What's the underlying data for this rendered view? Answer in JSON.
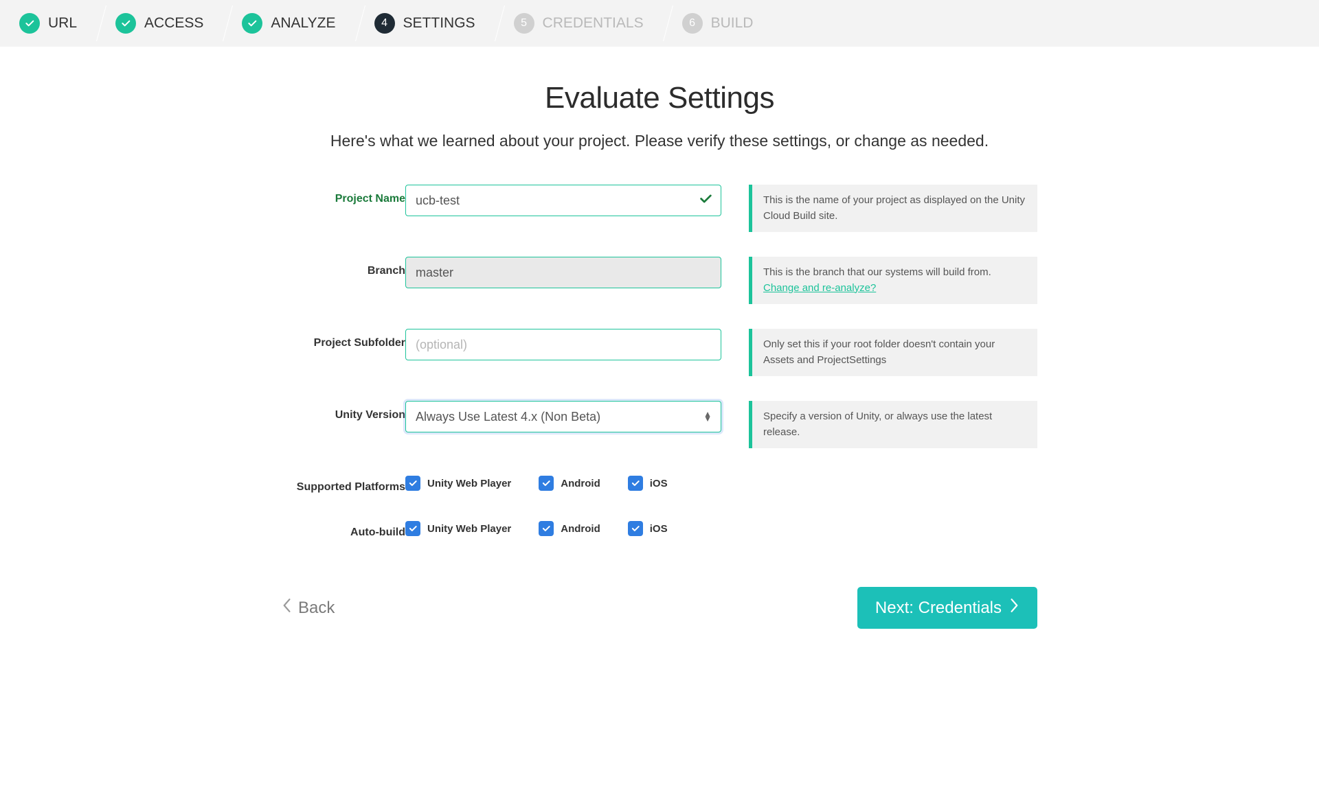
{
  "stepper": [
    {
      "label": "URL",
      "state": "done"
    },
    {
      "label": "ACCESS",
      "state": "done"
    },
    {
      "label": "ANALYZE",
      "state": "done"
    },
    {
      "label": "SETTINGS",
      "state": "current",
      "num": "4"
    },
    {
      "label": "CREDENTIALS",
      "state": "future",
      "num": "5"
    },
    {
      "label": "BUILD",
      "state": "future",
      "num": "6"
    }
  ],
  "title": "Evaluate Settings",
  "subtitle": "Here's what we learned about your project. Please verify these settings, or change as needed.",
  "form": {
    "projectName": {
      "label": "Project Name",
      "value": "ucb-test",
      "hint": "This is the name of your project as displayed on the Unity Cloud Build site."
    },
    "branch": {
      "label": "Branch",
      "value": "master",
      "hint": "This is the branch that our systems will build from.",
      "hintLink": "Change and re-analyze?"
    },
    "subfolder": {
      "label": "Project Subfolder",
      "value": "",
      "placeholder": "(optional)",
      "hint": "Only set this if your root folder doesn't contain your Assets and ProjectSettings"
    },
    "version": {
      "label": "Unity Version",
      "value": "Always Use Latest 4.x (Non Beta)",
      "hint": "Specify a version of Unity, or always use the latest release."
    },
    "platforms": {
      "label": "Supported Platforms",
      "items": [
        {
          "label": "Unity Web Player",
          "checked": true
        },
        {
          "label": "Android",
          "checked": true
        },
        {
          "label": "iOS",
          "checked": true
        }
      ]
    },
    "autoBuild": {
      "label": "Auto-build",
      "items": [
        {
          "label": "Unity Web Player",
          "checked": true
        },
        {
          "label": "Android",
          "checked": true
        },
        {
          "label": "iOS",
          "checked": true
        }
      ]
    }
  },
  "footer": {
    "back": "Back",
    "next": "Next: Credentials"
  }
}
